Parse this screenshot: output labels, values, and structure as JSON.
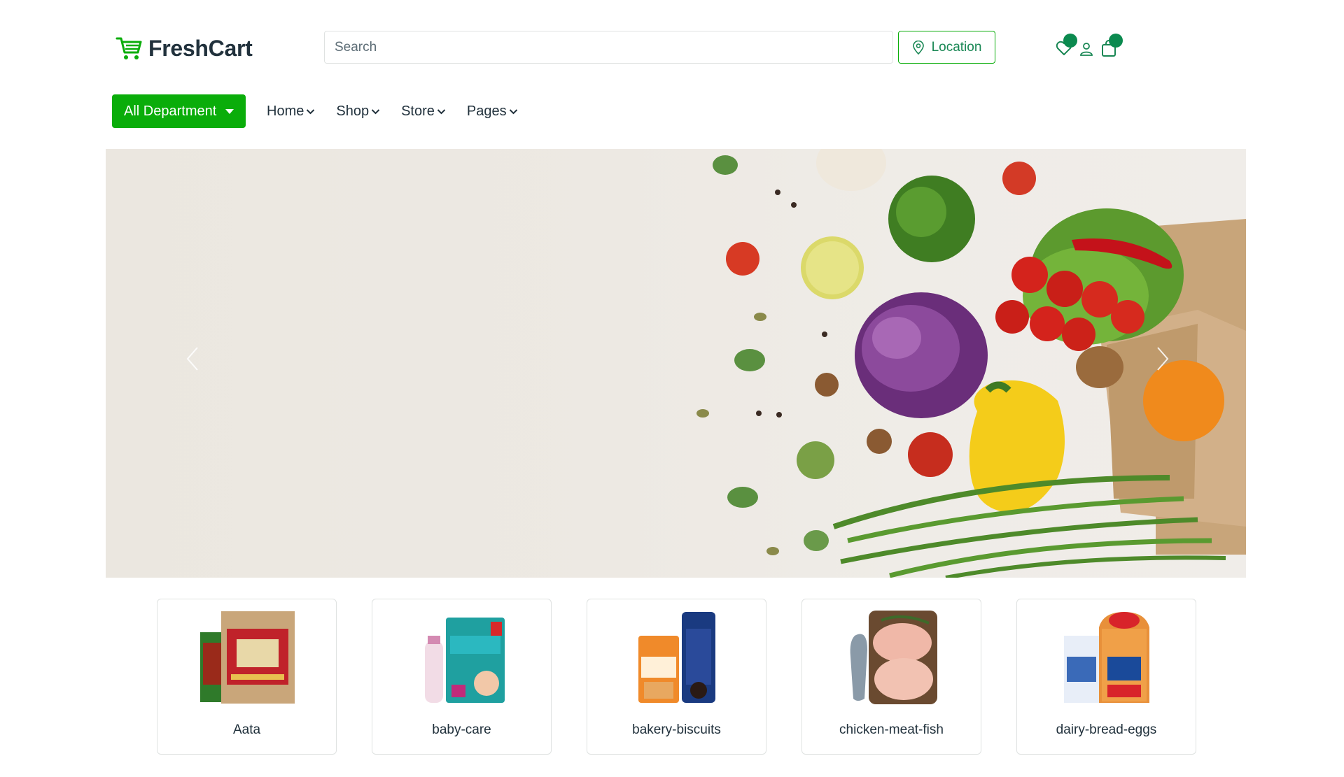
{
  "header": {
    "brand": "FreshCart",
    "search_placeholder": "Search",
    "location_label": "Location",
    "icons": [
      "heart-icon",
      "user-icon",
      "shopping-bag-icon"
    ]
  },
  "nav": {
    "department_label": "All Department",
    "items": [
      {
        "label": "Home"
      },
      {
        "label": "Shop"
      },
      {
        "label": "Store"
      },
      {
        "label": "Pages"
      }
    ]
  },
  "categories": [
    {
      "label": "Aata"
    },
    {
      "label": "baby-care"
    },
    {
      "label": "bakery-biscuits"
    },
    {
      "label": "chicken-meat-fish"
    },
    {
      "label": "dairy-bread-eggs"
    }
  ],
  "colors": {
    "primary": "#0aad0a",
    "brand_dark": "#21313c",
    "badge": "#0b8a4f"
  }
}
